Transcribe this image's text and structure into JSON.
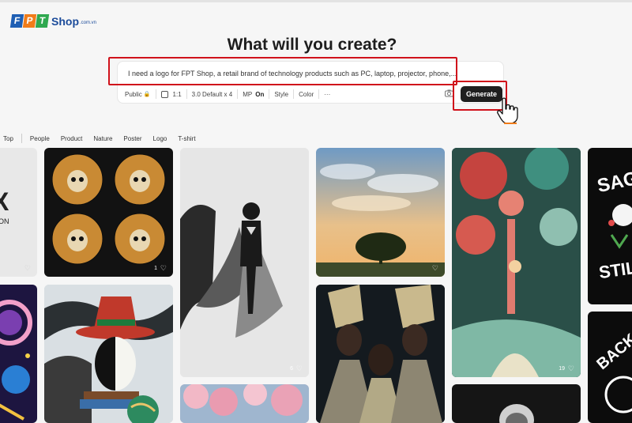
{
  "brand": {
    "logo_letters": [
      "F",
      "P",
      "T"
    ],
    "shop": "Shop",
    "domain": ".com.vn"
  },
  "heading": "What will you create?",
  "prompt": {
    "text": "I need a logo for FPT Shop, a retail brand of technology products such as PC, laptop, projector, phone,..."
  },
  "toolbar": {
    "visibility": "Public",
    "aspect": "1:1",
    "model": "3.0 Default x 4",
    "mp_label": "MP",
    "mp_value": "On",
    "style": "Style",
    "color": "Color",
    "more": "···",
    "generate": "Generate"
  },
  "categories": [
    "Top",
    "People",
    "Product",
    "Nature",
    "Poster",
    "Logo",
    "T-shirt"
  ],
  "gallery": {
    "counts": {
      "skulls": "1",
      "superman": "6",
      "forest": "19"
    },
    "partial_text": {
      "left_big": "X",
      "left_small": "ON",
      "right_a": "SAG",
      "right_b": "STIL",
      "right_c": "BACK"
    },
    "heart_icon": "heart-icon"
  },
  "colors": {
    "accent_red": "#d0121b",
    "button_dark": "#1f1f1f"
  }
}
